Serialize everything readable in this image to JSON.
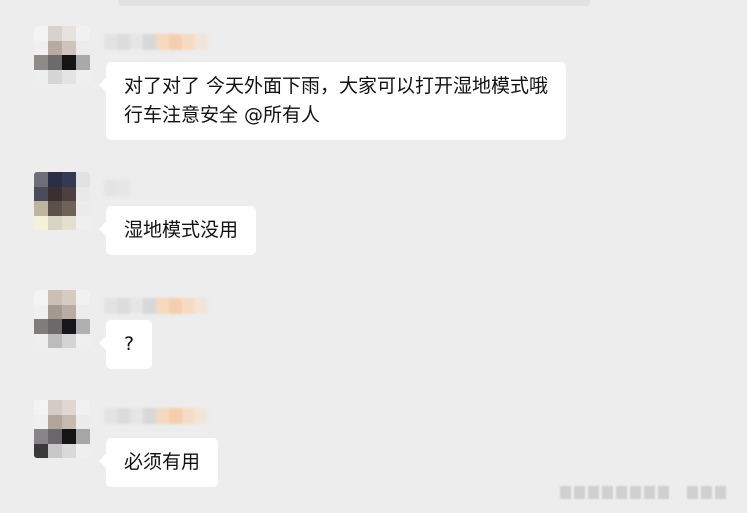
{
  "colors": {
    "background": "#ededed",
    "bubble": "#ffffff",
    "text": "#111111"
  },
  "messages": [
    {
      "sender_avatar": "pixelated-avatar",
      "text": "对了对了  今天外面下雨，大家可以打开湿地模式哦\n行车注意安全 @所有人"
    },
    {
      "sender_avatar": "pixelated-avatar",
      "text": "湿地模式没用"
    },
    {
      "sender_avatar": "pixelated-avatar",
      "text": "?"
    },
    {
      "sender_avatar": "pixelated-avatar",
      "text": "必须有用"
    }
  ]
}
